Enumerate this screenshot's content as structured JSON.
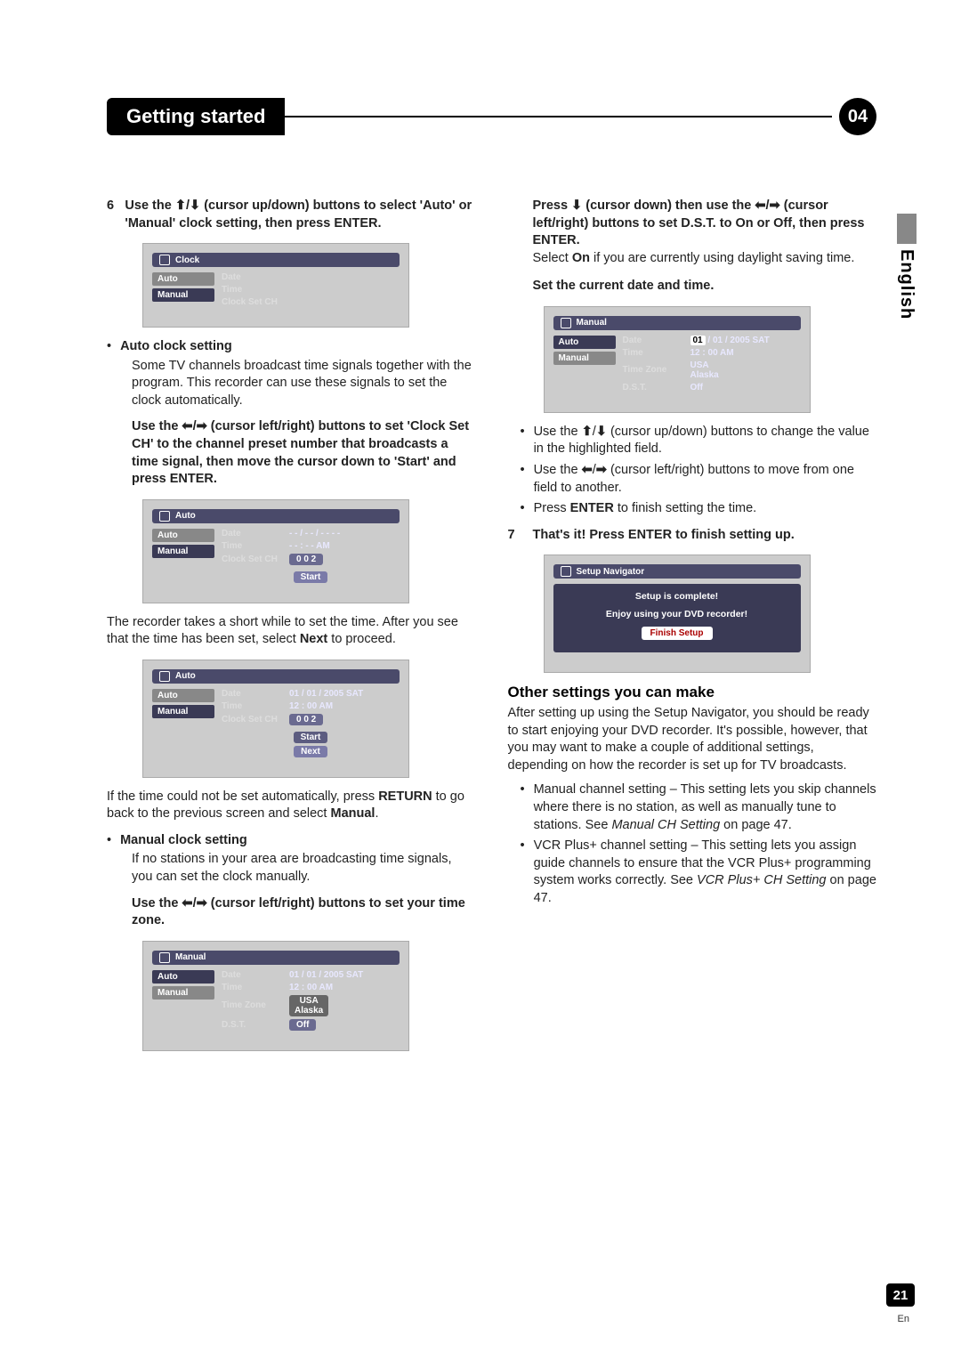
{
  "header": {
    "chapter_title": "Getting started",
    "chapter_number": "04"
  },
  "side": {
    "language": "English"
  },
  "page": {
    "number": "21",
    "lang_abbr": "En"
  },
  "left": {
    "step6_num": "6",
    "step6_text_a": "Use the ",
    "step6_text_b": " (cursor up/down) buttons to select 'Auto' or 'Manual' clock setting, then press ENTER.",
    "osd_clock": {
      "title": "Clock",
      "left_items": [
        "Auto",
        "Manual"
      ],
      "selected": "Auto",
      "rows": [
        {
          "label": "Date",
          "value": ""
        },
        {
          "label": "Time",
          "value": ""
        },
        {
          "label": "Clock Set CH",
          "value": ""
        }
      ]
    },
    "auto_head": "Auto clock setting",
    "auto_body": "Some TV channels broadcast time signals together with the program. This recorder can use these signals to set the clock automatically.",
    "auto_instr_a": "Use the ",
    "auto_instr_b": " (cursor left/right) buttons to set 'Clock Set CH' to the channel preset number that broadcasts a time signal, then move the cursor down to 'Start' and press ENTER.",
    "osd_auto1": {
      "title": "Auto",
      "left_items": [
        "Auto",
        "Manual"
      ],
      "selected": "Auto",
      "rows": [
        {
          "label": "Date",
          "value": "- -  /  - -  /  - - - -"
        },
        {
          "label": "Time",
          "value": "- -  :  - -   AM"
        },
        {
          "label": "Clock Set CH",
          "value": "0 0 2",
          "pill": true
        }
      ],
      "button": "Start"
    },
    "auto_after_a": "The recorder takes a short while to set the time. After you see that the time has been set, select ",
    "auto_after_b": "Next",
    "auto_after_c": " to proceed.",
    "osd_auto2": {
      "title": "Auto",
      "left_items": [
        "Auto",
        "Manual"
      ],
      "selected": "Auto",
      "rows": [
        {
          "label": "Date",
          "value": "01  /  01  /  2005  SAT"
        },
        {
          "label": "Time",
          "value": "12 : 00  AM"
        },
        {
          "label": "Clock Set CH",
          "value": "0 0 2",
          "pill": true
        }
      ],
      "buttons": [
        "Start",
        "Next"
      ]
    },
    "auto_fail_a": "If the time could not be set automatically, press ",
    "auto_fail_b": "RETURN",
    "auto_fail_c": " to go back to the previous screen and select ",
    "auto_fail_d": "Manual",
    "auto_fail_e": ".",
    "manual_head": "Manual clock setting",
    "manual_body": "If no stations in your area are broadcasting time signals, you can set the clock manually.",
    "manual_instr_a": "Use the ",
    "manual_instr_b": " (cursor left/right) buttons to set your time zone.",
    "osd_manual1": {
      "title": "Manual",
      "left_items": [
        "Auto",
        "Manual"
      ],
      "selected": "Manual",
      "rows": [
        {
          "label": "Date",
          "value": "01  /  01  /  2005  SAT"
        },
        {
          "label": "Time",
          "value": "12 : 00  AM"
        },
        {
          "label": "Time Zone",
          "tz": [
            "USA",
            "Alaska"
          ]
        },
        {
          "label": "D.S.T.",
          "value": "Off",
          "pill": true
        }
      ]
    }
  },
  "right": {
    "dst_instr_a": "Press ",
    "dst_instr_b": " (cursor down) then use the ",
    "dst_instr_c": " (cursor left/right) buttons to set D.S.T. to On or Off, then press ENTER.",
    "dst_body_a": "Select ",
    "dst_body_b": "On",
    "dst_body_c": " if you are currently using daylight saving time.",
    "set_datetime_head": "Set the current date and time.",
    "osd_manual2": {
      "title": "Manual",
      "left_items": [
        "Auto",
        "Manual"
      ],
      "selected": "Manual",
      "date_parts": {
        "hl": "01",
        "rest": " /  01  /  2005  SAT"
      },
      "rows": [
        {
          "label": "Date"
        },
        {
          "label": "Time",
          "value": "12  :  00   AM"
        },
        {
          "label": "Time Zone",
          "tz_plain": [
            "USA",
            "Alaska"
          ]
        },
        {
          "label": "D.S.T.",
          "value": "Off"
        }
      ]
    },
    "tips": [
      {
        "a": "Use the ",
        "b": " (cursor up/down) buttons to change the value in the highlighted field."
      },
      {
        "a": "Use the ",
        "b": " (cursor left/right) buttons to move from one field to another."
      },
      {
        "plain_a": "Press ",
        "bold": "ENTER",
        "plain_b": " to finish setting the time."
      }
    ],
    "step7_num": "7",
    "step7_text": "That's it! Press ENTER to finish setting up.",
    "osd_finish": {
      "title": "Setup Navigator",
      "line1": "Setup is complete!",
      "line2": "Enjoy using your DVD recorder!",
      "button": "Finish Setup"
    },
    "other_head": "Other settings you can make",
    "other_body": "After setting up using the Setup Navigator, you should be ready to start enjoying your DVD recorder. It's possible, however, that you may want to make a couple of additional settings, depending on how the recorder is set up for TV broadcasts.",
    "other_items": [
      {
        "text_a": "Manual channel setting – This setting lets you skip channels where there is no station, as well as manually tune to stations. See ",
        "ital": "Manual CH Setting",
        "text_b": " on page 47."
      },
      {
        "text_a": "VCR Plus+ channel setting – This setting lets you assign guide channels to ensure that the VCR Plus+ programming system works correctly. See ",
        "ital": "VCR Plus+ CH Setting",
        "text_b": " on page 47."
      }
    ]
  },
  "glyphs": {
    "up": "⬆",
    "down": "⬇",
    "left": "⬅",
    "right": "➡",
    "slash": "/"
  }
}
